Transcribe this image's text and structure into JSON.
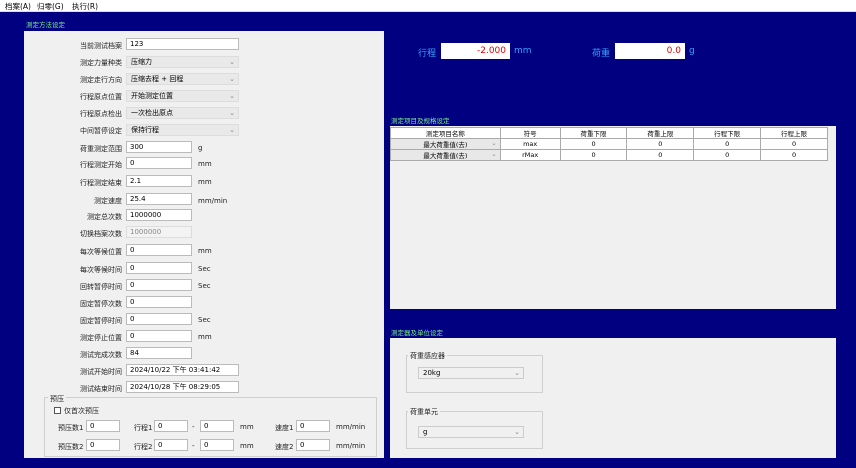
{
  "menu": [
    "档案(A)",
    "归零(G)",
    "执行(R)"
  ],
  "method_section": {
    "title": "测定方法设定",
    "fields": {
      "current_file": {
        "label": "当前测试档案",
        "value": "123"
      },
      "force_type": {
        "label": "测定力量种类",
        "value": "压缩力"
      },
      "direction": {
        "label": "测定走行方向",
        "value": "压缩去程 + 回程"
      },
      "origin_pos": {
        "label": "行程原点位置",
        "value": "开始测定位置"
      },
      "origin_detect": {
        "label": "行程原点检出",
        "value": "一次检出原点"
      },
      "mid_pause": {
        "label": "中间暂停设定",
        "value": "保持行程"
      },
      "load_range": {
        "label": "荷重测定范围",
        "value": "300",
        "unit": "g"
      },
      "stroke_start": {
        "label": "行程测定开始",
        "value": "0",
        "unit": "mm"
      },
      "stroke_end": {
        "label": "行程测定结束",
        "value": "2.1",
        "unit": "mm"
      },
      "speed": {
        "label": "测定速度",
        "value": "25.4",
        "unit": "mm/min"
      },
      "total_count": {
        "label": "测定总次数",
        "value": "1000000"
      },
      "switch_count": {
        "label": "切换档案次数",
        "value": "1000000"
      },
      "wait_pos": {
        "label": "每次等候位置",
        "value": "0",
        "unit": "mm"
      },
      "wait_time": {
        "label": "每次等候时间",
        "value": "0",
        "unit": "Sec"
      },
      "return_pause": {
        "label": "回转暂停时间",
        "value": "0",
        "unit": "Sec"
      },
      "fixed_pause_count": {
        "label": "固定暂停次数",
        "value": "0"
      },
      "fixed_pause_time": {
        "label": "固定暂停时间",
        "value": "0",
        "unit": "Sec"
      },
      "stop_pos": {
        "label": "测定停止位置",
        "value": "0",
        "unit": "mm"
      },
      "done_count": {
        "label": "测试完成次数",
        "value": "84"
      },
      "start_time": {
        "label": "测试开始时间",
        "value": "2024/10/22 下午 03:41:42"
      },
      "end_time": {
        "label": "测试结束时间",
        "value": "2024/10/28 下午 08:29:05"
      }
    },
    "preload": {
      "title": "预压",
      "first_only": "仅首次预压",
      "rows": [
        {
          "count_label": "预压数1",
          "count": "0",
          "stroke_label": "行程1",
          "from": "0",
          "dash": "-",
          "to": "0",
          "stroke_unit": "mm",
          "speed_label": "速度1",
          "speed": "0",
          "speed_unit": "mm/min"
        },
        {
          "count_label": "预压数2",
          "count": "0",
          "stroke_label": "行程2",
          "from": "0",
          "dash": "-",
          "to": "0",
          "stroke_unit": "mm",
          "speed_label": "速度2",
          "speed": "0",
          "speed_unit": "mm/min"
        }
      ]
    }
  },
  "readout": {
    "stroke_label": "行程",
    "stroke_value": "-2.000",
    "stroke_unit": "mm",
    "load_label": "荷重",
    "load_value": "0.0",
    "load_unit": "g"
  },
  "spec_section": {
    "title": "测定项目及规格设定",
    "headers": [
      "测定项目名称",
      "符号",
      "荷重下限",
      "荷重上限",
      "行程下限",
      "行程上限"
    ],
    "rows": [
      [
        "最大荷重值(去)",
        "max",
        "0",
        "0",
        "0",
        "0"
      ],
      [
        "最大荷重值(去)",
        "rMax",
        "0",
        "0",
        "0",
        "0"
      ]
    ]
  },
  "sensor_section": {
    "title": "测定器及单位设定",
    "sensor_label": "荷重感应器",
    "sensor_value": "20kg",
    "unit_label": "荷重单元",
    "unit_value": "g"
  }
}
